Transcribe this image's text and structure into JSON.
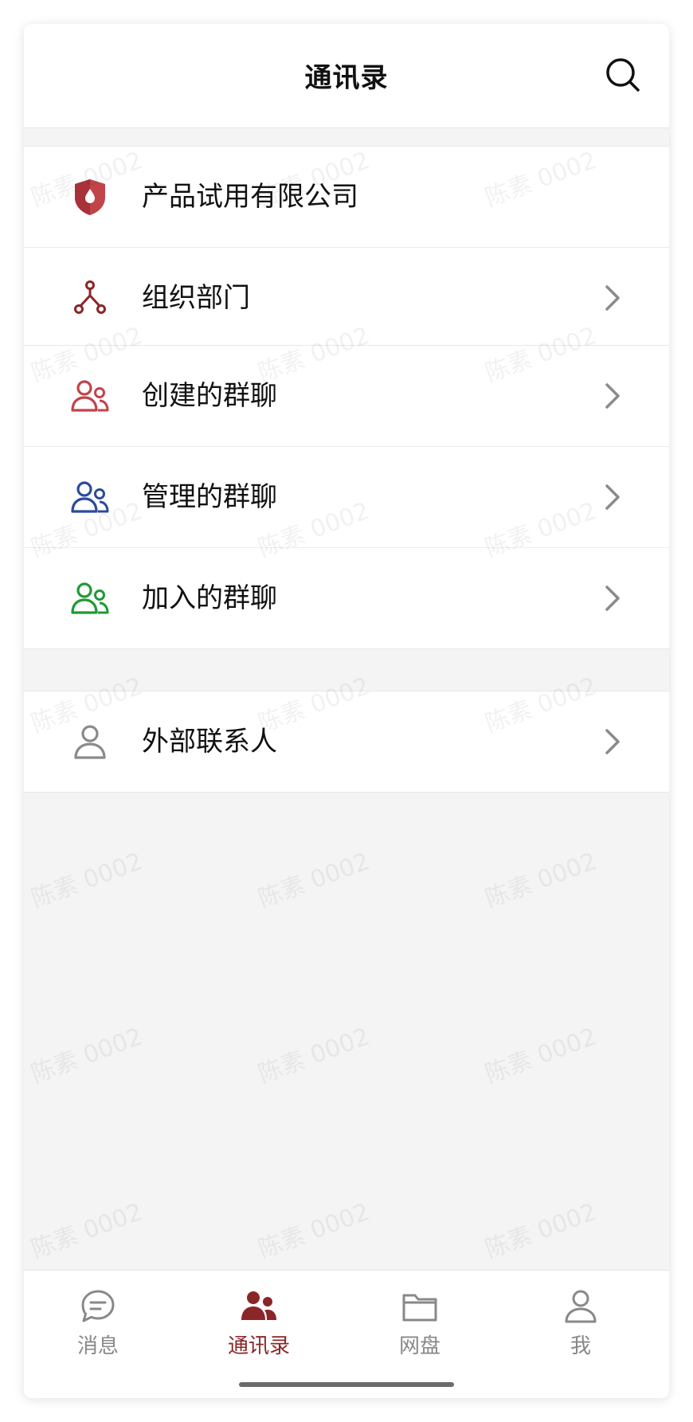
{
  "header": {
    "title": "通讯录"
  },
  "groups": [
    {
      "rows": [
        {
          "label": "产品试用有限公司",
          "icon": "company-shield-icon"
        },
        {
          "label": "组织部门",
          "icon": "org-tree-icon"
        }
      ]
    },
    {
      "rows": [
        {
          "label": "创建的群聊",
          "icon": "group-red-icon"
        },
        {
          "label": "管理的群聊",
          "icon": "group-blue-icon"
        },
        {
          "label": "加入的群聊",
          "icon": "group-green-icon"
        }
      ]
    },
    {
      "rows": [
        {
          "label": "外部联系人",
          "icon": "person-icon"
        }
      ]
    }
  ],
  "watermark": {
    "text": "陈素 0002"
  },
  "tabbar": {
    "tabs": [
      {
        "label": "消息",
        "icon": "message-icon"
      },
      {
        "label": "通讯录",
        "icon": "contacts-icon",
        "active": true
      },
      {
        "label": "网盘",
        "icon": "folder-icon"
      },
      {
        "label": "我",
        "icon": "profile-icon"
      }
    ]
  },
  "colors": {
    "accent": "#8a2628",
    "red": "#c0444a",
    "blue": "#2e4a9a",
    "green": "#1f9a35",
    "gray": "#8a8a8a"
  }
}
